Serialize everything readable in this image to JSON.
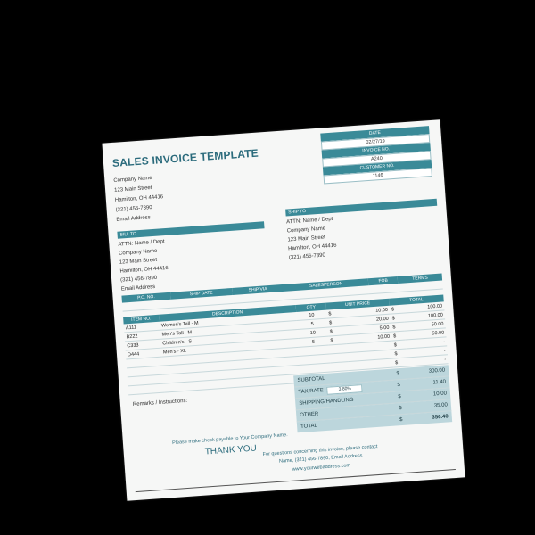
{
  "title": "SALES INVOICE TEMPLATE",
  "company": [
    "Company Name",
    "123 Main Street",
    "Hamilton, OH 44416",
    "(321) 456-7890",
    "Email Address"
  ],
  "meta": {
    "date_label": "DATE",
    "date_value": "02/27/19",
    "invoice_label": "INVOICE NO.",
    "invoice_value": "A240",
    "customer_label": "CUSTOMER NO.",
    "customer_value": "1146"
  },
  "bill_to": {
    "label": "BILL TO",
    "lines": [
      "ATTN: Name / Dept",
      "Company Name",
      "123 Main Street",
      "Hamilton, OH 44416",
      "(321) 456-7890",
      "Email Address"
    ]
  },
  "ship_to": {
    "label": "SHIP TO",
    "lines": [
      "ATTN: Name / Dept",
      "Company Name",
      "123 Main Street",
      "Hamilton, OH 44416",
      "(321) 456-7890"
    ]
  },
  "order_headers": [
    "P.O. NO.",
    "SHIP DATE",
    "SHIP VIA",
    "SALESPERSON",
    "FOB",
    "TERMS"
  ],
  "item_headers": [
    "ITEM NO.",
    "DESCRIPTION",
    "QTY",
    "UNIT PRICE",
    "TOTAL"
  ],
  "items": [
    {
      "no": "A111",
      "desc": "Women's Tall - M",
      "qty": "10",
      "cur1": "$",
      "price": "10.00",
      "cur2": "$",
      "total": "100.00"
    },
    {
      "no": "B222",
      "desc": "Men's Tall - M",
      "qty": "5",
      "cur1": "$",
      "price": "20.00",
      "cur2": "$",
      "total": "100.00"
    },
    {
      "no": "C333",
      "desc": "Children's - S",
      "qty": "10",
      "cur1": "$",
      "price": "5.00",
      "cur2": "$",
      "total": "50.00"
    },
    {
      "no": "D444",
      "desc": "Men's - XL",
      "qty": "5",
      "cur1": "$",
      "price": "10.00",
      "cur2": "$",
      "total": "50.00"
    },
    {
      "no": "",
      "desc": "",
      "qty": "",
      "cur1": "",
      "price": "",
      "cur2": "$",
      "total": "-"
    },
    {
      "no": "",
      "desc": "",
      "qty": "",
      "cur1": "",
      "price": "",
      "cur2": "$",
      "total": "-"
    },
    {
      "no": "",
      "desc": "",
      "qty": "",
      "cur1": "",
      "price": "",
      "cur2": "$",
      "total": "-"
    },
    {
      "no": "",
      "desc": "",
      "qty": "",
      "cur1": "",
      "price": "",
      "cur2": "$",
      "total": "-"
    }
  ],
  "remarks_label": "Remarks / Instructions:",
  "totals": {
    "subtotal_label": "SUBTOTAL",
    "subtotal": "300.00",
    "tax_label": "TAX RATE",
    "tax_rate": "3.80%",
    "tax": "11.40",
    "shipping_label": "SHIPPING/HANDLING",
    "shipping": "10.00",
    "other_label": "OTHER",
    "other": "35.00",
    "total_label": "TOTAL",
    "total": "356.40",
    "currency": "$"
  },
  "footer": {
    "payable": "Please make check payable to Your Company Name.",
    "thanks": "THANK YOU",
    "questions": "For questions concerning this invoice, please contact",
    "contact": "Name, (321) 456-7890, Email Address",
    "website": "www.yourwebaddress.com"
  }
}
